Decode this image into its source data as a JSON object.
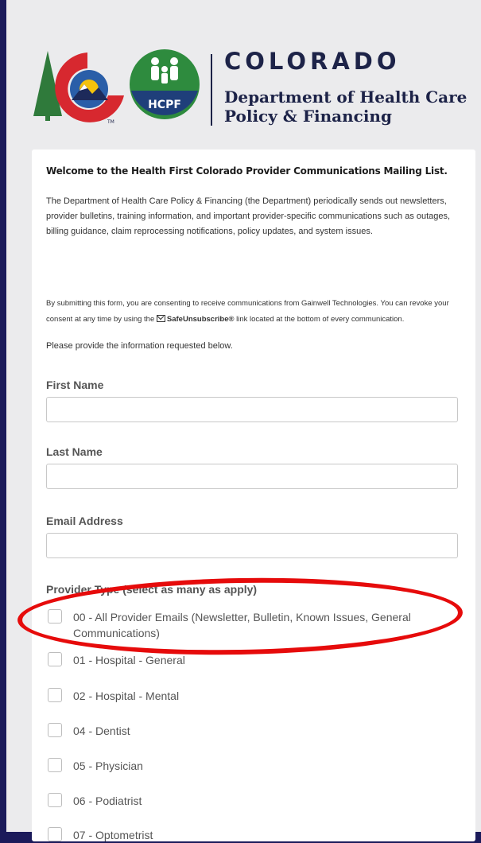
{
  "header": {
    "brand": "COLORADO",
    "dept_line1": "Department of Health Care",
    "dept_line2": "Policy & Financing",
    "hcpf_badge": "HCPF",
    "tm": "TM"
  },
  "intro": {
    "welcome": "Welcome to the Health First Colorado Provider Communications Mailing List.",
    "paragraph": "The Department of Health Care Policy & Financing (the Department) periodically sends out newsletters, provider bulletins, training information, and important provider-specific communications such as outages, billing guidance, claim reprocessing notifications, policy updates, and system issues.",
    "consent_before": "By submitting this form, you are consenting to receive communications from Gainwell Technologies. You can revoke your consent at any time by using the ",
    "consent_link": "SafeUnsubscribe®",
    "consent_after": " link located at the bottom of every communication.",
    "request": "Please provide the information requested below."
  },
  "form": {
    "first_name_label": "First Name",
    "first_name_value": "",
    "last_name_label": "Last Name",
    "last_name_value": "",
    "email_label": "Email Address",
    "email_value": "",
    "provider_type_label": "Provider Type (select as many as apply)",
    "options": [
      {
        "label": "00 - All Provider Emails (Newsletter, Bulletin, Known Issues, General Communications)",
        "checked": false
      },
      {
        "label": "01 - Hospital - General",
        "checked": false
      },
      {
        "label": "02 - Hospital - Mental",
        "checked": false
      },
      {
        "label": "04 - Dentist",
        "checked": false
      },
      {
        "label": "05 - Physician",
        "checked": false
      },
      {
        "label": "06 - Podiatrist",
        "checked": false
      },
      {
        "label": "07 - Optometrist",
        "checked": false
      }
    ]
  },
  "colors": {
    "background": "#1b1a5a",
    "panel": "#ebebed",
    "brand_navy": "#1d2348",
    "highlight": "#e60b0b",
    "hcpf_green": "#2e8b3e"
  }
}
